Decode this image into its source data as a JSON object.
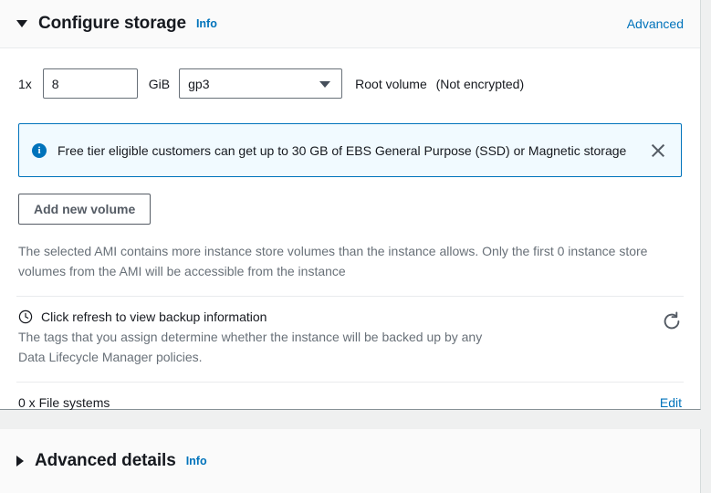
{
  "storage_section": {
    "title": "Configure storage",
    "info_label": "Info",
    "advanced_link": "Advanced",
    "expanded_caret": "caret-down-icon",
    "volume": {
      "multiplier": "1x",
      "size_value": "8",
      "size_placeholder": "8",
      "unit": "GiB",
      "volume_type": "gp3",
      "volume_type_caret": "chevron-down-icon",
      "root_label": "Root volume",
      "encryption_status": "(Not encrypted)"
    },
    "alert": {
      "icon": "info-circle-icon",
      "message": "Free tier eligible customers can get up to 30 GB of EBS General Purpose (SSD) or Magnetic storage",
      "close_icon": "close-icon"
    },
    "add_volume_button": "Add new volume",
    "note": "The selected AMI contains more instance store volumes than the instance allows. Only the first 0 instance store volumes from the AMI will be accessible from the instance",
    "backup": {
      "icon": "clock-icon",
      "heading": "Click refresh to view backup information",
      "description_line1": "The tags that you assign determine whether the instance will be backed up by any",
      "description_line2": "Data Lifecycle Manager policies.",
      "refresh_icon": "refresh-icon"
    },
    "file_systems": {
      "label": "0 x File systems",
      "edit_link": "Edit"
    }
  },
  "advanced_section": {
    "title": "Advanced details",
    "info_label": "Info",
    "collapsed_caret": "caret-right-icon"
  },
  "colors": {
    "link": "#0073bb",
    "text": "#16191f",
    "muted": "#687078",
    "border": "#687078",
    "alert_bg": "#f1faff",
    "alert_border": "#0073bb",
    "page_bg": "#eff0f0",
    "header_bg": "#fafafa"
  }
}
